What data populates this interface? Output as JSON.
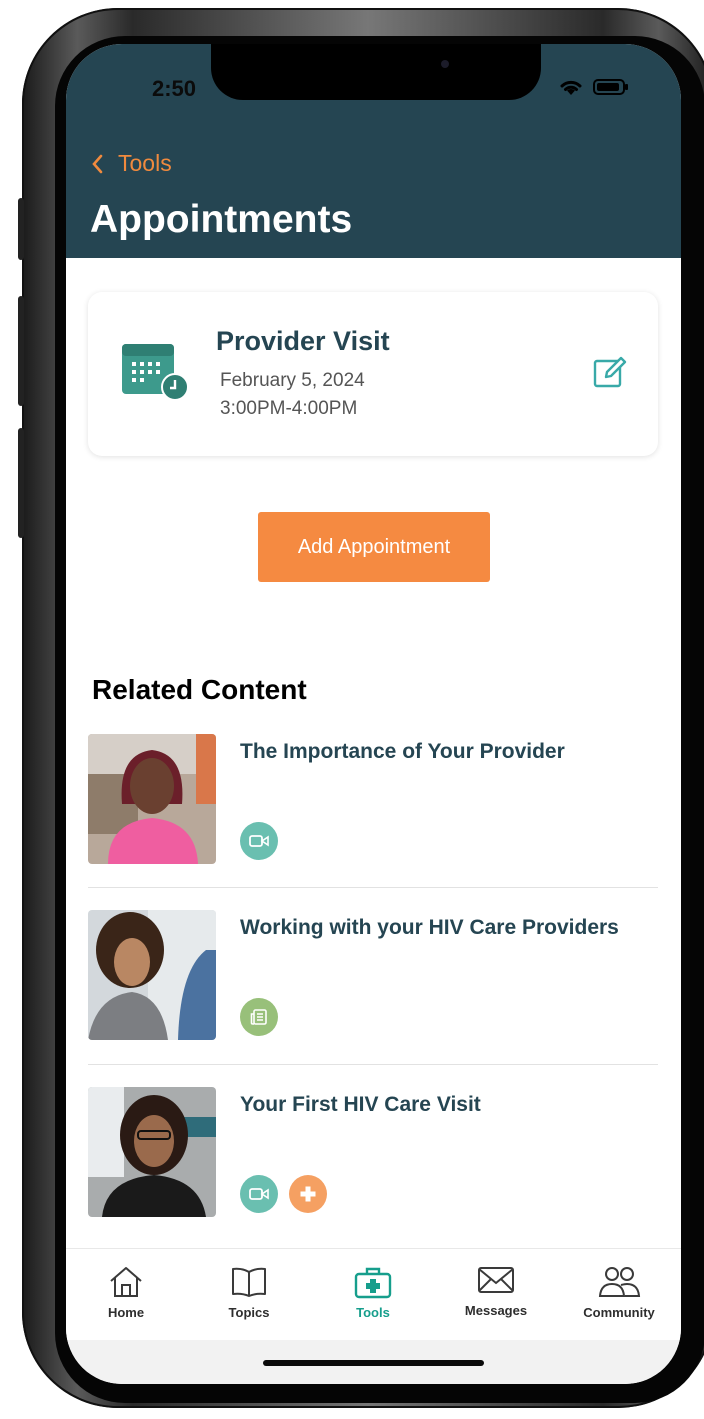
{
  "status": {
    "time": "2:50"
  },
  "header": {
    "back_label": "Tools",
    "title": "Appointments"
  },
  "appointment": {
    "title": "Provider Visit",
    "date": "February 5, 2024",
    "time": "3:00PM-4:00PM",
    "icon": "calendar-clock-icon",
    "edit_icon": "edit-icon"
  },
  "add_button_label": "Add Appointment",
  "related": {
    "title": "Related Content",
    "items": [
      {
        "title": "The Importance of Your Provider",
        "badges": [
          "video"
        ]
      },
      {
        "title": "Working with your HIV Care Providers",
        "badges": [
          "article"
        ]
      },
      {
        "title": "Your First HIV Care Visit",
        "badges": [
          "video",
          "health"
        ]
      }
    ]
  },
  "tabbar": {
    "tabs": [
      {
        "label": "Home",
        "icon": "home-icon"
      },
      {
        "label": "Topics",
        "icon": "book-icon"
      },
      {
        "label": "Tools",
        "icon": "medical-kit-icon",
        "active": true
      },
      {
        "label": "Messages",
        "icon": "envelope-icon"
      },
      {
        "label": "Community",
        "icon": "people-icon"
      }
    ]
  },
  "colors": {
    "header_bg": "#254552",
    "accent_orange": "#f58a41",
    "teal": "#169e8c",
    "badge_teal": "#6abfb0",
    "badge_green": "#98c07a",
    "badge_orange": "#f5a062"
  }
}
